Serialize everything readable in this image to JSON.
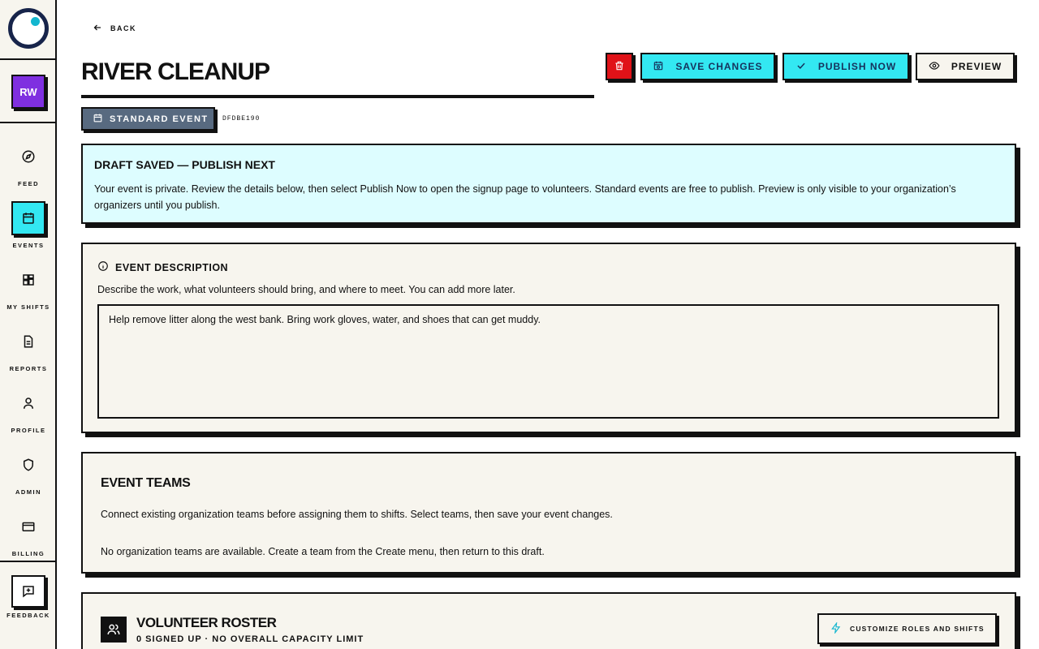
{
  "sidebar": {
    "avatar_initials": "RW",
    "items": [
      {
        "label": "FEED",
        "icon": "compass-icon"
      },
      {
        "label": "EVENTS",
        "icon": "calendar-icon"
      },
      {
        "label": "MY SHIFTS",
        "icon": "grid-icon"
      },
      {
        "label": "REPORTS",
        "icon": "document-icon"
      },
      {
        "label": "PROFILE",
        "icon": "user-icon"
      },
      {
        "label": "ADMIN",
        "icon": "shield-icon"
      },
      {
        "label": "BILLING",
        "icon": "credit-card-icon"
      }
    ],
    "feedback_label": "FEEDBACK"
  },
  "header": {
    "back_label": "BACK",
    "title": "RIVER CLEANUP",
    "event_type": "STANDARD EVENT",
    "event_id": "DFDBE190"
  },
  "actions": {
    "save_label": "SAVE CHANGES",
    "publish_label": "PUBLISH NOW",
    "preview_label": "PREVIEW"
  },
  "notice": {
    "title": "DRAFT SAVED — PUBLISH NEXT",
    "body": "Your event is private. Review the details below, then select Publish Now to open the signup page to volunteers. Standard events are free to publish. Preview is only visible to your organization’s organizers until you publish."
  },
  "description": {
    "heading": "EVENT DESCRIPTION",
    "hint": "Describe the work, what volunteers should bring, and where to meet. You can add more later.",
    "value": "Help remove litter along the west bank. Bring work gloves, water, and shoes that can get muddy."
  },
  "teams": {
    "heading": "EVENT TEAMS",
    "intro": "Connect existing organization teams before assigning them to shifts. Select teams, then save your event changes.",
    "empty": "No organization teams are available. Create a team from the Create menu, then return to this draft."
  },
  "roster": {
    "heading": "VOLUNTEER ROSTER",
    "subtitle": "0 SIGNED UP · NO OVERALL CAPACITY LIMIT",
    "customize_label": "CUSTOMIZE ROLES AND SHIFTS"
  },
  "colors": {
    "accent": "#33e8f2",
    "delete": "#e01218",
    "avatar": "#7f2fe0",
    "event_type_bg": "#586a80",
    "notice_bg": "#ddfdff",
    "card_bg": "#f7f5ee"
  }
}
